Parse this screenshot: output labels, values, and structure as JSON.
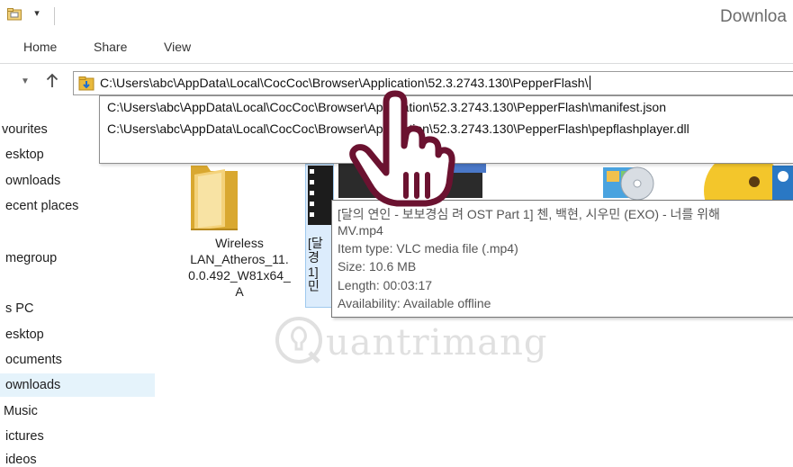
{
  "window": {
    "title": "Downloa"
  },
  "ribbon": {
    "tabs": [
      "Home",
      "Share",
      "View"
    ]
  },
  "address": {
    "path": "C:\\Users\\abc\\AppData\\Local\\CocCoc\\Browser\\Application\\52.3.2743.130\\PepperFlash\\"
  },
  "suggestions": [
    "C:\\Users\\abc\\AppData\\Local\\CocCoc\\Browser\\Application\\52.3.2743.130\\PepperFlash\\manifest.json",
    "C:\\Users\\abc\\AppData\\Local\\CocCoc\\Browser\\Application\\52.3.2743.130\\PepperFlash\\pepflashplayer.dll"
  ],
  "nav": {
    "items": [
      "vourites",
      "esktop",
      "ownloads",
      "ecent places",
      "megroup",
      "s PC",
      "esktop",
      "ocuments",
      "ownloads",
      "Music",
      "ictures",
      "ideos"
    ]
  },
  "files": {
    "wireless": {
      "lines": [
        "Wireless",
        "LAN_Atheros_11.",
        "0.0.492_W81x64_",
        "A"
      ]
    },
    "video_partial": {
      "lines": [
        "[달",
        "경",
        "1]",
        "민"
      ]
    }
  },
  "tooltip": {
    "line1": "[달의 연인 - 보보경심 려 OST Part 1] 첸, 백현, 시우민 (EXO) - 너를 위해",
    "line2": "MV.mp4",
    "item_type": "Item type: VLC media file (.mp4)",
    "size": "Size: 10.6 MB",
    "length": "Length: 00:03:17",
    "availability": "Availability: Available offline"
  },
  "watermark": {
    "text": "uantrimang"
  },
  "colors": {
    "folder": "#e8b93c",
    "nav_selected": "#e5f3fb",
    "address_border": "#9b9b9b",
    "watermark": "#c8c8c8"
  },
  "icons": {
    "qat": "folder-properties-icon",
    "recent": "chevron-down-icon",
    "up": "up-arrow-icon",
    "address": "download-folder-icon",
    "cursor": "hand-pointer-icon"
  }
}
